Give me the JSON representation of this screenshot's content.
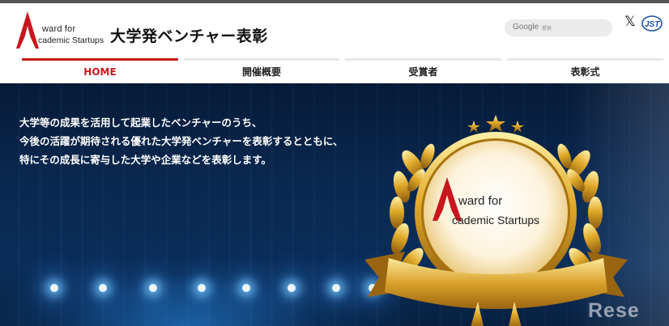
{
  "brand": {
    "logo_line1": "ward for",
    "logo_line2": "cademic Startups",
    "title": "大学発ベンチャー表彰",
    "accent_color": "#c9161d"
  },
  "search": {
    "brand": "Google",
    "sublabel": "提供"
  },
  "social": {
    "x_icon": "𝕏",
    "jst_label": "JST"
  },
  "nav": {
    "items": [
      {
        "label": "HOME",
        "active": true
      },
      {
        "label": "開催概要",
        "active": false
      },
      {
        "label": "受賞者",
        "active": false
      },
      {
        "label": "表彰式",
        "active": false
      }
    ]
  },
  "hero": {
    "lines": [
      "大学等の成果を活用して起業したベンチャーのうち、",
      "今後の活躍が期待される優れた大学発ベンチャーを表彰するとともに、",
      "特にその成長に寄与した大学や企業などを表彰します。"
    ],
    "award_line1": "ward for",
    "award_line2": "cademic Startups"
  },
  "watermark": "Rese"
}
